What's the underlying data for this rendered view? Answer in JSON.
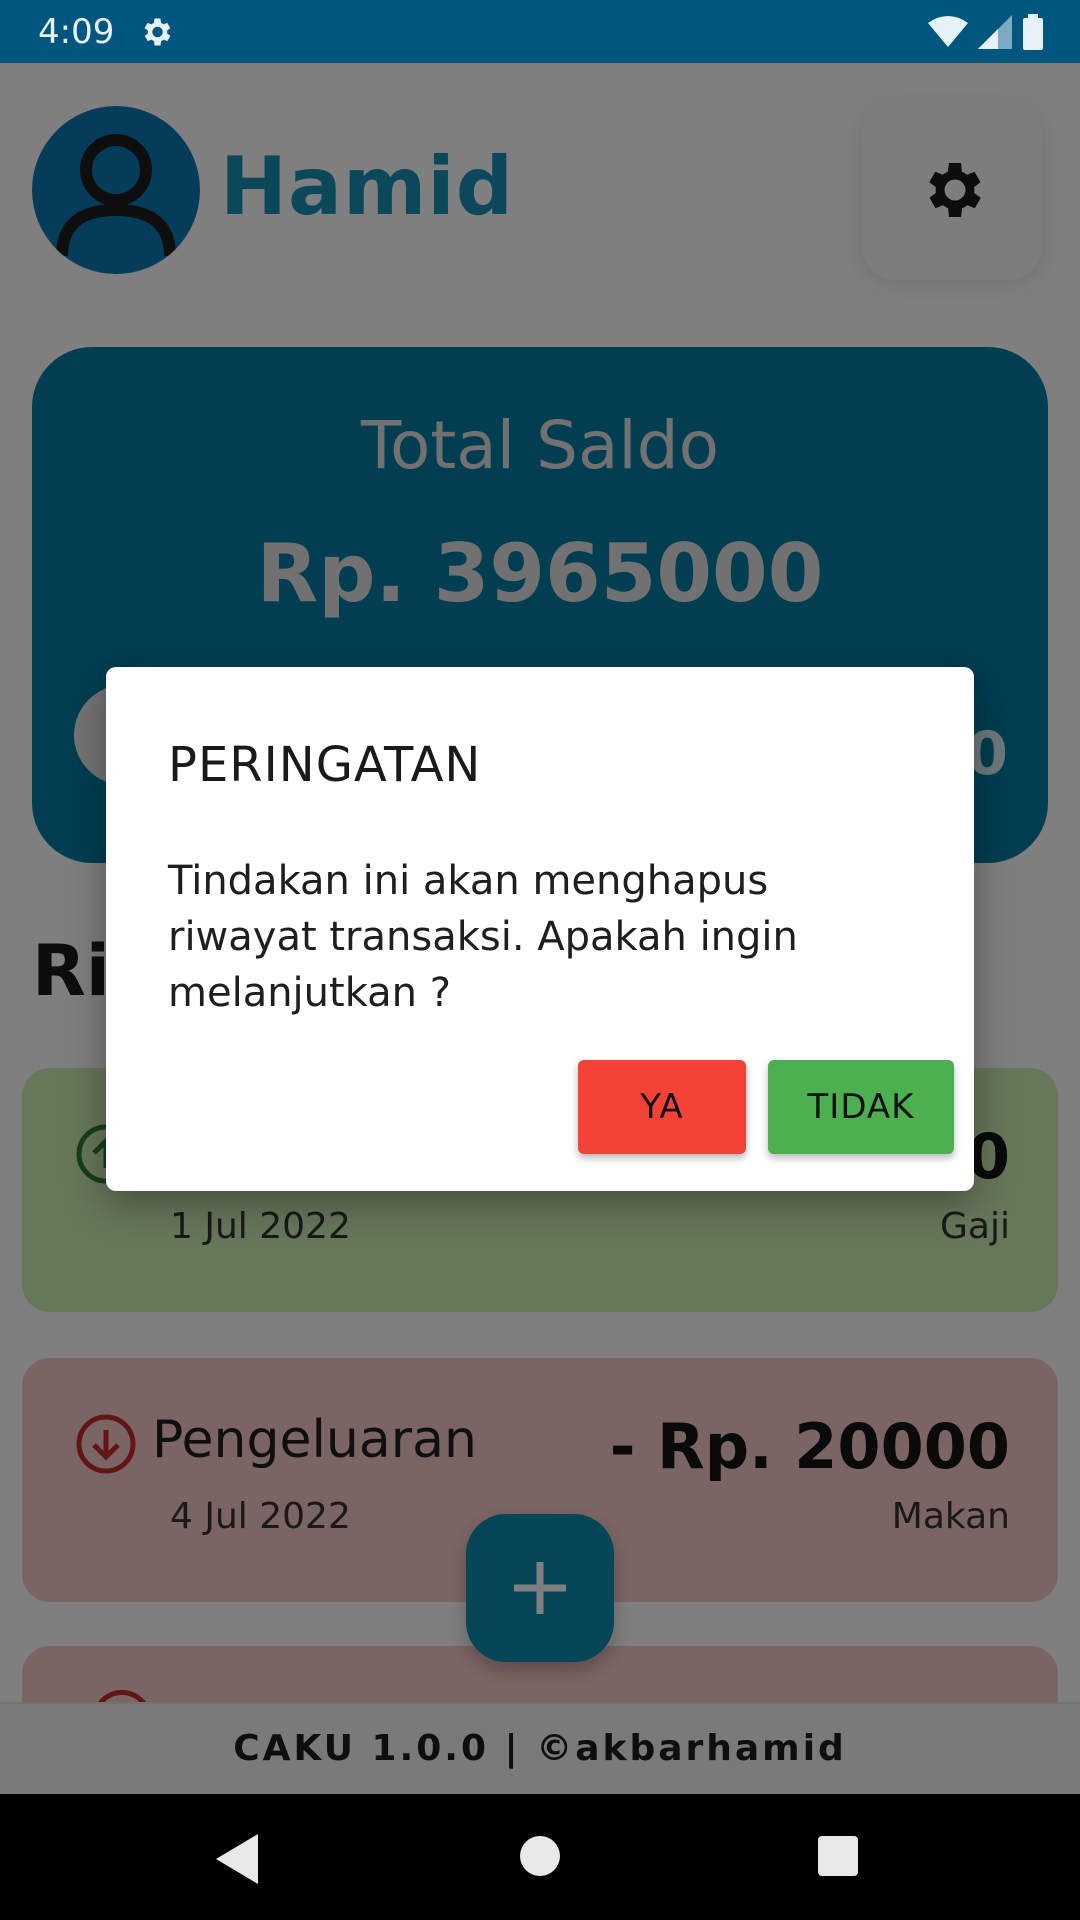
{
  "status_bar": {
    "time": "4:09",
    "icons": [
      "settings-icon",
      "wifi-icon",
      "signal-icon",
      "battery-icon"
    ]
  },
  "header": {
    "user_name": "Hamid",
    "avatar_icon": "person-icon",
    "settings_icon": "gear-icon"
  },
  "balance": {
    "label": "Total Saldo",
    "amount": "Rp. 3965000",
    "right_peek": "0"
  },
  "history": {
    "title_peek": "Ri",
    "transactions": [
      {
        "type": "",
        "date": "1 Jul 2022",
        "amount": "0",
        "category": "Gaji",
        "icon": "arrow-up-circle-icon"
      },
      {
        "type": "Pengeluaran",
        "date": "4 Jul 2022",
        "amount": "- Rp. 20000",
        "category": "Makan",
        "icon": "arrow-down-circle-icon"
      }
    ]
  },
  "fab": {
    "icon": "plus-icon"
  },
  "footer": {
    "text": "CAKU 1.0.0 | ©akbarhamid"
  },
  "dialog": {
    "title": "PERINGATAN",
    "message": "Tindakan ini akan menghapus riwayat transaksi. Apakah ingin melanjutkan ?",
    "confirm_label": "YA",
    "cancel_label": "TIDAK"
  },
  "colors": {
    "status_bar": "#00567e",
    "primary": "#027da3",
    "name": "#1792b4",
    "income_card": "#cfeeb4",
    "expense_card": "#f7c9c9",
    "confirm_button": "#f44336",
    "cancel_button": "#4caf50"
  }
}
